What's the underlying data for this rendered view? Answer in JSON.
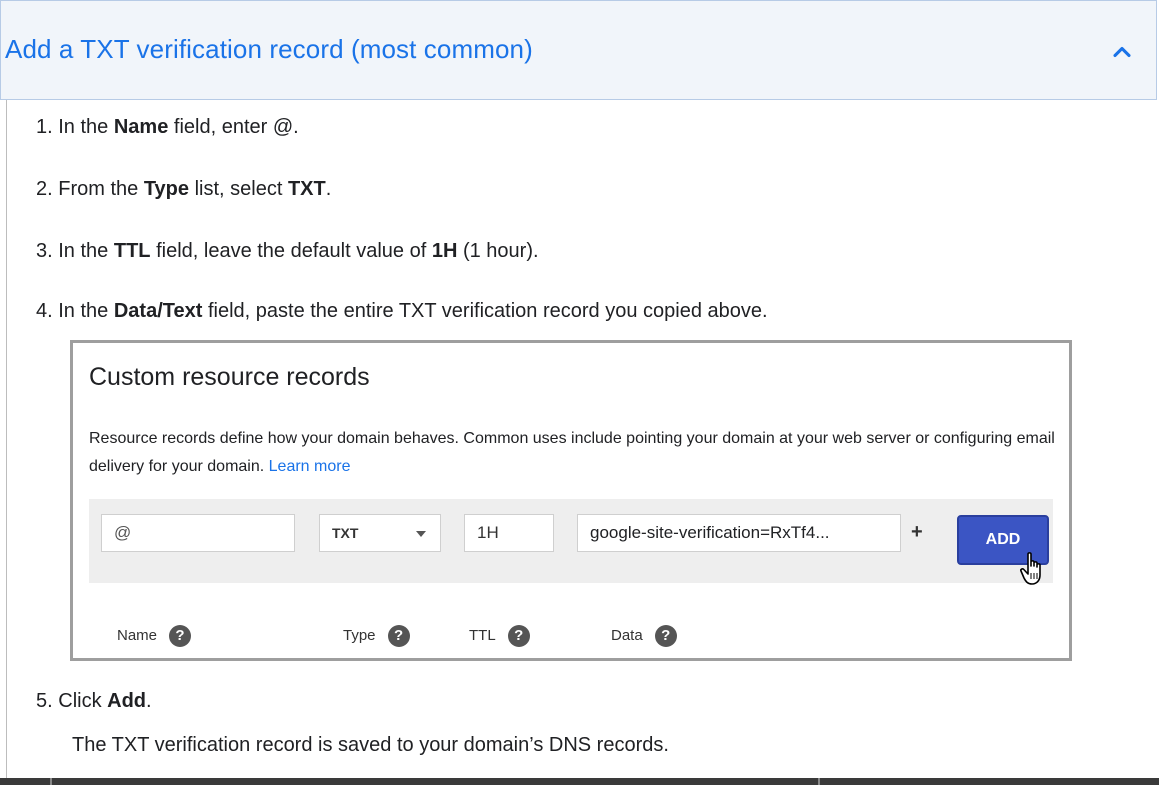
{
  "accordion": {
    "title": "Add a TXT verification record (most common)",
    "expanded": true,
    "icon": "chevron-up-icon"
  },
  "steps": {
    "s1": {
      "num": "1.",
      "pre": "In the ",
      "bold": "Name",
      "post": " field, enter @."
    },
    "s2": {
      "num": "2.",
      "pre": "From the ",
      "bold1": "Type",
      "mid": " list, select ",
      "bold2": "TXT",
      "post": "."
    },
    "s3": {
      "num": "3.",
      "pre": "In the ",
      "bold1": "TTL",
      "mid": " field, leave the default value of ",
      "bold2": "1H",
      "post": " (1 hour)."
    },
    "s4": {
      "num": "4.",
      "pre": "In the ",
      "bold": "Data/Text",
      "post": " field, paste the entire TXT verification record you copied above."
    },
    "s5": {
      "num": "5.",
      "pre": "Click ",
      "bold": "Add",
      "post": "."
    },
    "s5_sub": "The TXT verification record is saved to your domain’s DNS records."
  },
  "panel": {
    "title": "Custom resource records",
    "description": "Resource records define how your domain behaves. Common uses include pointing your domain at your web server or configuring email delivery for your domain.",
    "learn_more": "Learn more",
    "form": {
      "name_value": "@",
      "type_value": "TXT",
      "ttl_value": "1H",
      "data_value": "google-site-verification=RxTf4...",
      "plus": "+",
      "add_label": "ADD"
    },
    "columns": {
      "name": "Name",
      "type": "Type",
      "ttl": "TTL",
      "data": "Data",
      "help": "?"
    }
  }
}
